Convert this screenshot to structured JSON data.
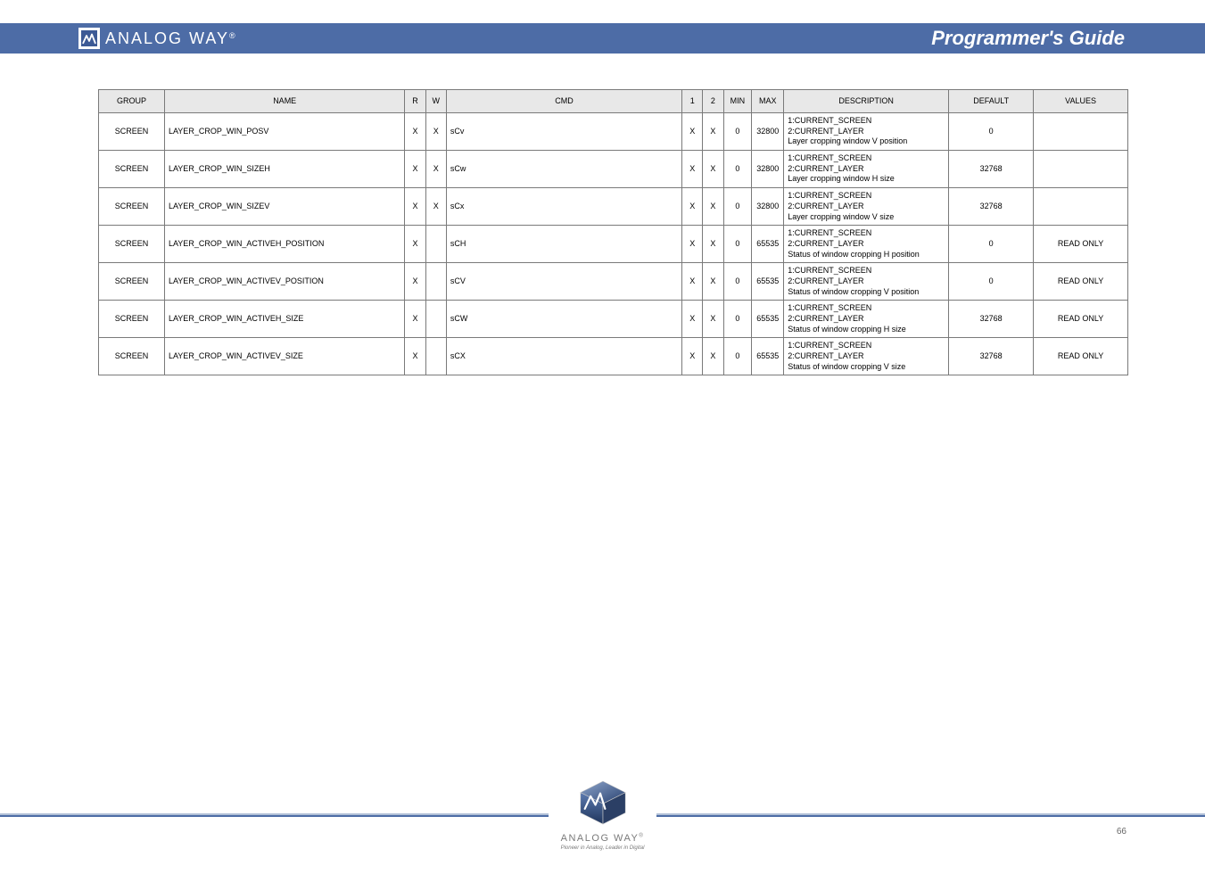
{
  "header": {
    "brand": "ANALOG WAY",
    "title": "Programmer's Guide"
  },
  "table": {
    "headers": [
      "GROUP",
      "NAME",
      "R",
      "W",
      "CMD",
      "1",
      "2",
      "MIN",
      "MAX",
      "DESCRIPTION",
      "DEFAULT",
      "VALUES"
    ],
    "rows": [
      {
        "group": "SCREEN",
        "name": "LAYER_CROP_WIN_POSV",
        "r": "X",
        "w": "X",
        "cmd": "sCv",
        "i1": "X",
        "i2": "X",
        "min": "0",
        "max": "32800",
        "desc_pre": "1:CURRENT_SCREEN\n2:CURRENT_LAYER\nLayer cropping window V position",
        "default": "0",
        "values": ""
      },
      {
        "group": "SCREEN",
        "name": "LAYER_CROP_WIN_SIZEH",
        "r": "X",
        "w": "X",
        "cmd": "sCw",
        "i1": "X",
        "i2": "X",
        "min": "0",
        "max": "32800",
        "desc_pre": "1:CURRENT_SCREEN\n2:CURRENT_LAYER\nLayer cropping window H size",
        "default": "32768",
        "values": ""
      },
      {
        "group": "SCREEN",
        "name": "LAYER_CROP_WIN_SIZEV",
        "r": "X",
        "w": "X",
        "cmd": "sCx",
        "i1": "X",
        "i2": "X",
        "min": "0",
        "max": "32800",
        "desc_pre": "1:CURRENT_SCREEN\n2:CURRENT_LAYER\nLayer cropping window V size",
        "default": "32768",
        "values": ""
      },
      {
        "group": "SCREEN",
        "name": "LAYER_CROP_WIN_ACTIVEH_POSITION",
        "r": "X",
        "w": "",
        "cmd": "sCH",
        "i1": "X",
        "i2": "X",
        "min": "0",
        "max": "65535",
        "desc_pre": "1:CURRENT_SCREEN\n2:CURRENT_LAYER\nStatus of window cropping H position",
        "default": "0",
        "values": "READ ONLY"
      },
      {
        "group": "SCREEN",
        "name": "LAYER_CROP_WIN_ACTIVEV_POSITION",
        "r": "X",
        "w": "",
        "cmd": "sCV",
        "i1": "X",
        "i2": "X",
        "min": "0",
        "max": "65535",
        "desc_pre": "1:CURRENT_SCREEN\n2:CURRENT_LAYER\nStatus of window cropping V position",
        "default": "0",
        "values": "READ ONLY"
      },
      {
        "group": "SCREEN",
        "name": "LAYER_CROP_WIN_ACTIVEH_SIZE",
        "r": "X",
        "w": "",
        "cmd": "sCW",
        "i1": "X",
        "i2": "X",
        "min": "0",
        "max": "65535",
        "desc_pre": "1:CURRENT_SCREEN\n2:CURRENT_LAYER\nStatus of window cropping H size",
        "default": "32768",
        "values": "READ ONLY"
      },
      {
        "group": "SCREEN",
        "name": "LAYER_CROP_WIN_ACTIVEV_SIZE",
        "r": "X",
        "w": "",
        "cmd": "sCX",
        "i1": "X",
        "i2": "X",
        "min": "0",
        "max": "65535",
        "desc_pre": "1:CURRENT_SCREEN\n2:CURRENT_LAYER\nStatus of window cropping V size",
        "default": "32768",
        "values": "READ ONLY"
      }
    ]
  },
  "footer": {
    "brand": "ANALOG WAY",
    "tagline": "Pioneer in Analog, Leader in Digital",
    "page": "66"
  }
}
